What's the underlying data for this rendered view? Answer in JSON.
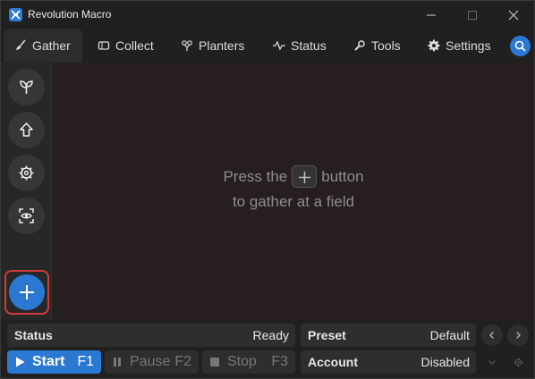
{
  "window": {
    "title": "Revolution Macro",
    "icon": "app-logo-icon"
  },
  "tabs": [
    {
      "label": "Gather",
      "icon": "broom-icon",
      "active": true
    },
    {
      "label": "Collect",
      "icon": "ticket-icon",
      "active": false
    },
    {
      "label": "Planters",
      "icon": "planter-icon",
      "active": false
    },
    {
      "label": "Status",
      "icon": "pulse-icon",
      "active": false
    },
    {
      "label": "Tools",
      "icon": "wrench-icon",
      "active": false
    },
    {
      "label": "Settings",
      "icon": "gear-icon",
      "active": false
    }
  ],
  "rail": {
    "items": [
      "sprout-icon",
      "upload-arrow-icon",
      "gear-icon",
      "eye-scan-icon"
    ],
    "add_button": "plus-icon"
  },
  "main": {
    "empty_prefix": "Press the",
    "empty_suffix": "button",
    "empty_line2": "to gather at a field"
  },
  "bottom": {
    "status_label": "Status",
    "status_value": "Ready",
    "preset_label": "Preset",
    "preset_value": "Default",
    "account_label": "Account",
    "account_value": "Disabled",
    "start_label": "Start",
    "start_key": "F1",
    "pause_label": "Pause",
    "pause_key": "F2",
    "stop_label": "Stop",
    "stop_key": "F3"
  },
  "colors": {
    "accent": "#2b78d2",
    "highlight_border": "#d13b3b",
    "background": "#202020",
    "main_panel": "#271f1f"
  }
}
